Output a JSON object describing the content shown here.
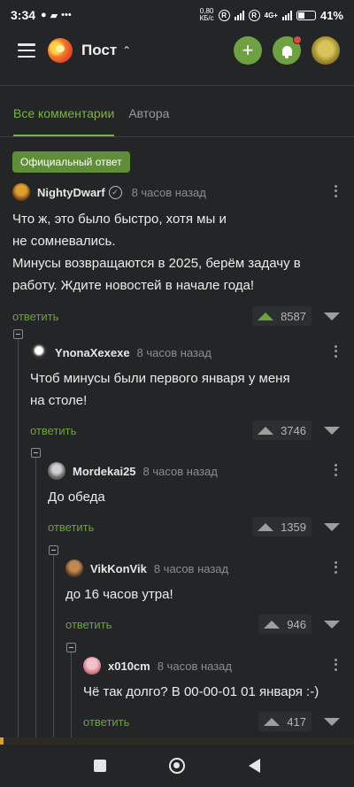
{
  "status_bar": {
    "time": "3:34",
    "net_speed": "0,80",
    "net_unit": "КБ/с",
    "signal2_label": "4G+",
    "battery": "41%",
    "battery_level": 0.41
  },
  "app_bar": {
    "title": "Пост",
    "add_icon": "plus-icon",
    "bell_icon": "bell-icon"
  },
  "tabs": [
    {
      "label": "Все комментарии"
    },
    {
      "label": "Автора"
    }
  ],
  "badge": "Официальный ответ",
  "comments": [
    {
      "author": "NightyDwarf",
      "time": "8 часов назад",
      "verified": true,
      "text": "Что ж, это было быстро, хотя мы и\nне сомневались.\nМинусы возвращаются в 2025, берём задачу в\nработу. Ждите новостей в начале года!",
      "reply": "ответить",
      "votes": "8587",
      "upvoted": true
    },
    {
      "author": "YnonaXexexe",
      "time": "8 часов назад",
      "text": "Чтоб минусы были первого января у меня\nна столе!",
      "reply": "ответить",
      "votes": "3746"
    },
    {
      "author": "Mordekai25",
      "time": "8 часов назад",
      "text": "До обеда",
      "reply": "ответить",
      "votes": "1359"
    },
    {
      "author": "VikKonVik",
      "time": "8 часов назад",
      "text": "до 16 часов утра!",
      "reply": "ответить",
      "votes": "946"
    },
    {
      "author": "x010cm",
      "time": "8 часов назад",
      "text": "Чё так долго? В 00-00-01 01 января :-)",
      "reply": "ответить",
      "votes": "417"
    }
  ],
  "colors": {
    "accent": "#6fa143",
    "background": "#232526",
    "notification": "#e04545"
  }
}
